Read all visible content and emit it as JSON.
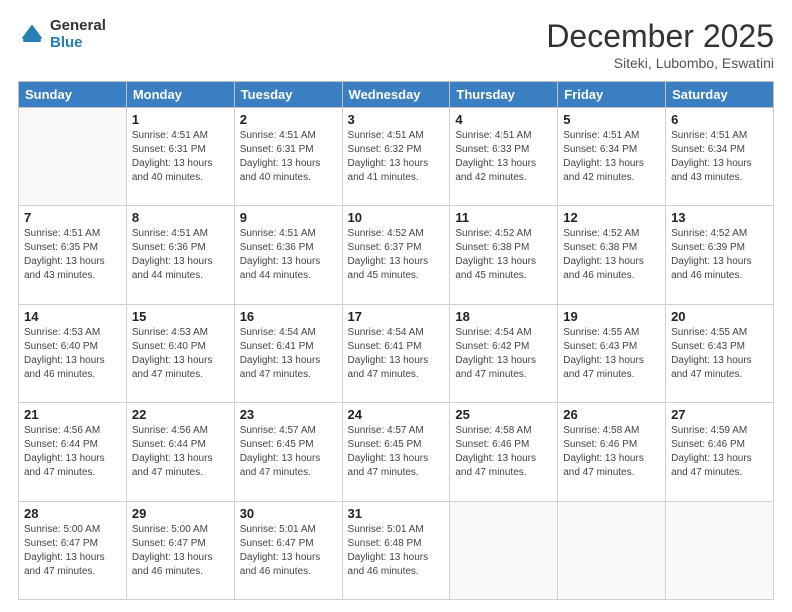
{
  "logo": {
    "general": "General",
    "blue": "Blue"
  },
  "title": "December 2025",
  "location": "Siteki, Lubombo, Eswatini",
  "days_of_week": [
    "Sunday",
    "Monday",
    "Tuesday",
    "Wednesday",
    "Thursday",
    "Friday",
    "Saturday"
  ],
  "weeks": [
    [
      {
        "day": "",
        "info": ""
      },
      {
        "day": "1",
        "info": "Sunrise: 4:51 AM\nSunset: 6:31 PM\nDaylight: 13 hours\nand 40 minutes."
      },
      {
        "day": "2",
        "info": "Sunrise: 4:51 AM\nSunset: 6:31 PM\nDaylight: 13 hours\nand 40 minutes."
      },
      {
        "day": "3",
        "info": "Sunrise: 4:51 AM\nSunset: 6:32 PM\nDaylight: 13 hours\nand 41 minutes."
      },
      {
        "day": "4",
        "info": "Sunrise: 4:51 AM\nSunset: 6:33 PM\nDaylight: 13 hours\nand 42 minutes."
      },
      {
        "day": "5",
        "info": "Sunrise: 4:51 AM\nSunset: 6:34 PM\nDaylight: 13 hours\nand 42 minutes."
      },
      {
        "day": "6",
        "info": "Sunrise: 4:51 AM\nSunset: 6:34 PM\nDaylight: 13 hours\nand 43 minutes."
      }
    ],
    [
      {
        "day": "7",
        "info": "Sunrise: 4:51 AM\nSunset: 6:35 PM\nDaylight: 13 hours\nand 43 minutes."
      },
      {
        "day": "8",
        "info": "Sunrise: 4:51 AM\nSunset: 6:36 PM\nDaylight: 13 hours\nand 44 minutes."
      },
      {
        "day": "9",
        "info": "Sunrise: 4:51 AM\nSunset: 6:36 PM\nDaylight: 13 hours\nand 44 minutes."
      },
      {
        "day": "10",
        "info": "Sunrise: 4:52 AM\nSunset: 6:37 PM\nDaylight: 13 hours\nand 45 minutes."
      },
      {
        "day": "11",
        "info": "Sunrise: 4:52 AM\nSunset: 6:38 PM\nDaylight: 13 hours\nand 45 minutes."
      },
      {
        "day": "12",
        "info": "Sunrise: 4:52 AM\nSunset: 6:38 PM\nDaylight: 13 hours\nand 46 minutes."
      },
      {
        "day": "13",
        "info": "Sunrise: 4:52 AM\nSunset: 6:39 PM\nDaylight: 13 hours\nand 46 minutes."
      }
    ],
    [
      {
        "day": "14",
        "info": "Sunrise: 4:53 AM\nSunset: 6:40 PM\nDaylight: 13 hours\nand 46 minutes."
      },
      {
        "day": "15",
        "info": "Sunrise: 4:53 AM\nSunset: 6:40 PM\nDaylight: 13 hours\nand 47 minutes."
      },
      {
        "day": "16",
        "info": "Sunrise: 4:54 AM\nSunset: 6:41 PM\nDaylight: 13 hours\nand 47 minutes."
      },
      {
        "day": "17",
        "info": "Sunrise: 4:54 AM\nSunset: 6:41 PM\nDaylight: 13 hours\nand 47 minutes."
      },
      {
        "day": "18",
        "info": "Sunrise: 4:54 AM\nSunset: 6:42 PM\nDaylight: 13 hours\nand 47 minutes."
      },
      {
        "day": "19",
        "info": "Sunrise: 4:55 AM\nSunset: 6:43 PM\nDaylight: 13 hours\nand 47 minutes."
      },
      {
        "day": "20",
        "info": "Sunrise: 4:55 AM\nSunset: 6:43 PM\nDaylight: 13 hours\nand 47 minutes."
      }
    ],
    [
      {
        "day": "21",
        "info": "Sunrise: 4:56 AM\nSunset: 6:44 PM\nDaylight: 13 hours\nand 47 minutes."
      },
      {
        "day": "22",
        "info": "Sunrise: 4:56 AM\nSunset: 6:44 PM\nDaylight: 13 hours\nand 47 minutes."
      },
      {
        "day": "23",
        "info": "Sunrise: 4:57 AM\nSunset: 6:45 PM\nDaylight: 13 hours\nand 47 minutes."
      },
      {
        "day": "24",
        "info": "Sunrise: 4:57 AM\nSunset: 6:45 PM\nDaylight: 13 hours\nand 47 minutes."
      },
      {
        "day": "25",
        "info": "Sunrise: 4:58 AM\nSunset: 6:46 PM\nDaylight: 13 hours\nand 47 minutes."
      },
      {
        "day": "26",
        "info": "Sunrise: 4:58 AM\nSunset: 6:46 PM\nDaylight: 13 hours\nand 47 minutes."
      },
      {
        "day": "27",
        "info": "Sunrise: 4:59 AM\nSunset: 6:46 PM\nDaylight: 13 hours\nand 47 minutes."
      }
    ],
    [
      {
        "day": "28",
        "info": "Sunrise: 5:00 AM\nSunset: 6:47 PM\nDaylight: 13 hours\nand 47 minutes."
      },
      {
        "day": "29",
        "info": "Sunrise: 5:00 AM\nSunset: 6:47 PM\nDaylight: 13 hours\nand 46 minutes."
      },
      {
        "day": "30",
        "info": "Sunrise: 5:01 AM\nSunset: 6:47 PM\nDaylight: 13 hours\nand 46 minutes."
      },
      {
        "day": "31",
        "info": "Sunrise: 5:01 AM\nSunset: 6:48 PM\nDaylight: 13 hours\nand 46 minutes."
      },
      {
        "day": "",
        "info": ""
      },
      {
        "day": "",
        "info": ""
      },
      {
        "day": "",
        "info": ""
      }
    ]
  ]
}
